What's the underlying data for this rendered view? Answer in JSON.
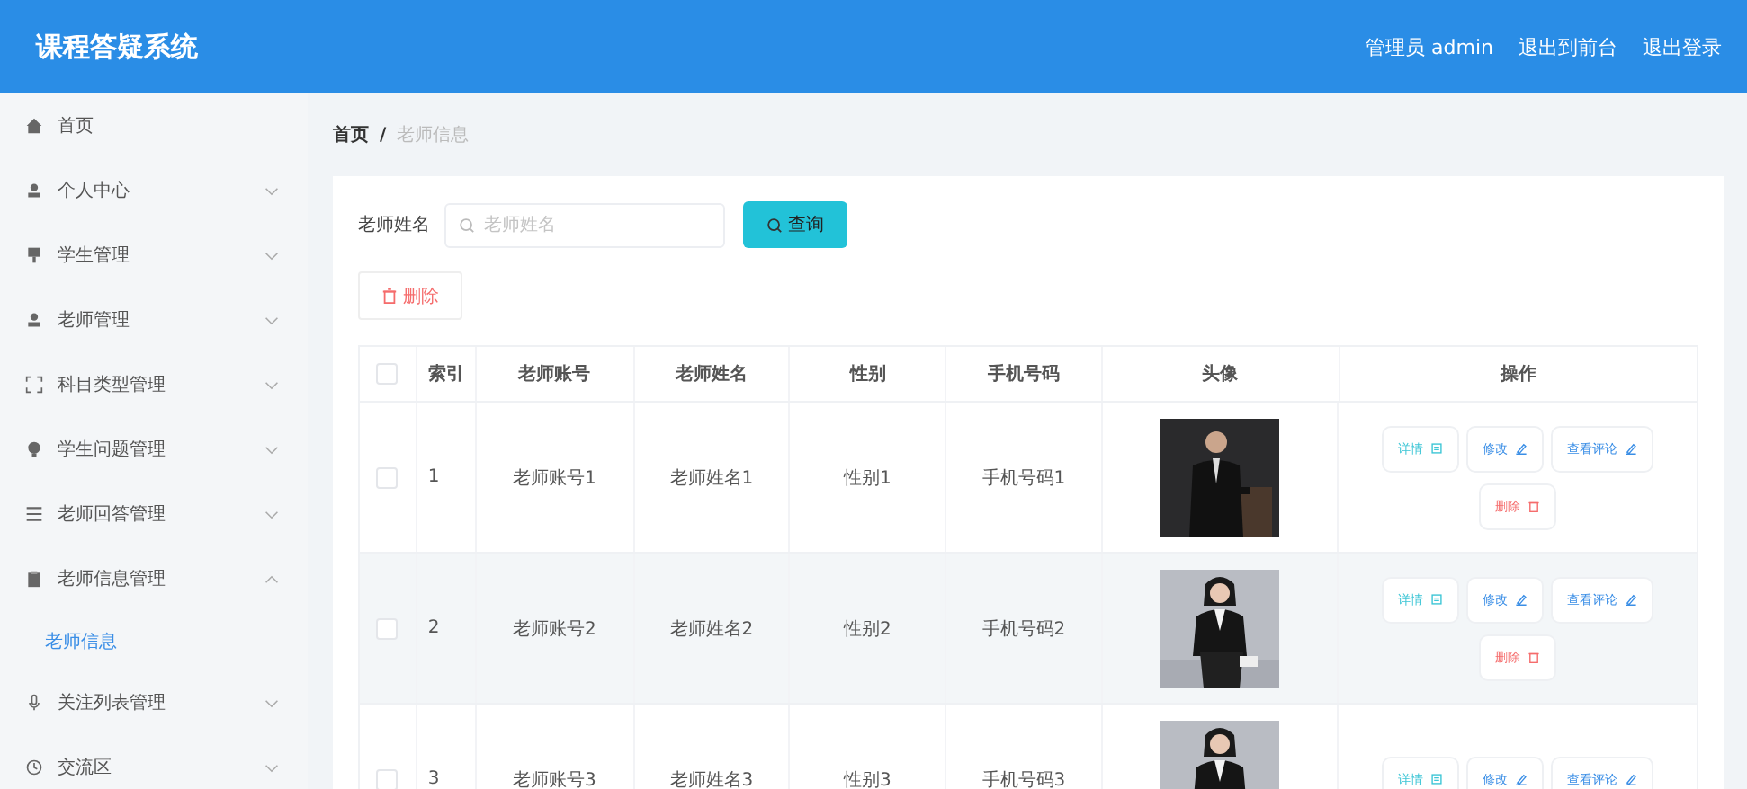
{
  "header": {
    "title": "课程答疑系统",
    "links": [
      "管理员 admin",
      "退出到前台",
      "退出登录"
    ]
  },
  "sidebar": {
    "items": [
      {
        "label": "首页"
      },
      {
        "label": "个人中心",
        "expanded": false
      },
      {
        "label": "学生管理",
        "expanded": false
      },
      {
        "label": "老师管理",
        "expanded": false
      },
      {
        "label": "科目类型管理",
        "expanded": false
      },
      {
        "label": "学生问题管理",
        "expanded": false
      },
      {
        "label": "老师回答管理",
        "expanded": false
      },
      {
        "label": "老师信息管理",
        "expanded": true,
        "children": [
          {
            "label": "老师信息",
            "selected": true
          }
        ]
      },
      {
        "label": "关注列表管理",
        "expanded": false
      },
      {
        "label": "交流区",
        "expanded": false
      }
    ]
  },
  "breadcrumb": {
    "items": [
      "首页",
      "老师信息"
    ],
    "separator": "/"
  },
  "search": {
    "label": "老师姓名",
    "placeholder": "老师姓名",
    "button": "查询"
  },
  "delete_button": "删除",
  "table": {
    "columns": [
      "索引",
      "老师账号",
      "老师姓名",
      "性别",
      "手机号码",
      "头像",
      "操作"
    ],
    "all_checked": false,
    "rows": [
      {
        "checked": false,
        "highlighted": false,
        "cells": [
          "1",
          "老师账号1",
          "老师姓名1",
          "性别1",
          "手机号码1"
        ],
        "photo": {
          "kind": "picture"
        },
        "actions": [
          {
            "kind": "detail",
            "label": "详情"
          },
          {
            "kind": "edit",
            "label": "修改"
          },
          {
            "kind": "comments",
            "label": "查看评论"
          },
          {
            "kind": "delete",
            "label": "删除"
          }
        ]
      },
      {
        "checked": false,
        "highlighted": true,
        "cells": [
          "2",
          "老师账号2",
          "老师姓名2",
          "性别2",
          "手机号码2"
        ],
        "photo": {
          "kind": "picture"
        },
        "actions": [
          {
            "kind": "detail",
            "label": "详情"
          },
          {
            "kind": "edit",
            "label": "修改"
          },
          {
            "kind": "comments",
            "label": "查看评论"
          },
          {
            "kind": "delete",
            "label": "删除"
          }
        ]
      },
      {
        "checked": false,
        "highlighted": false,
        "cells": [
          "3",
          "老师账号3",
          "老师姓名3",
          "性别3",
          "手机号码3"
        ],
        "photo": {
          "kind": "picture"
        },
        "actions": [
          {
            "kind": "detail",
            "label": "详情"
          },
          {
            "kind": "edit",
            "label": "修改"
          },
          {
            "kind": "comments",
            "label": "查看评论"
          }
        ]
      }
    ]
  }
}
